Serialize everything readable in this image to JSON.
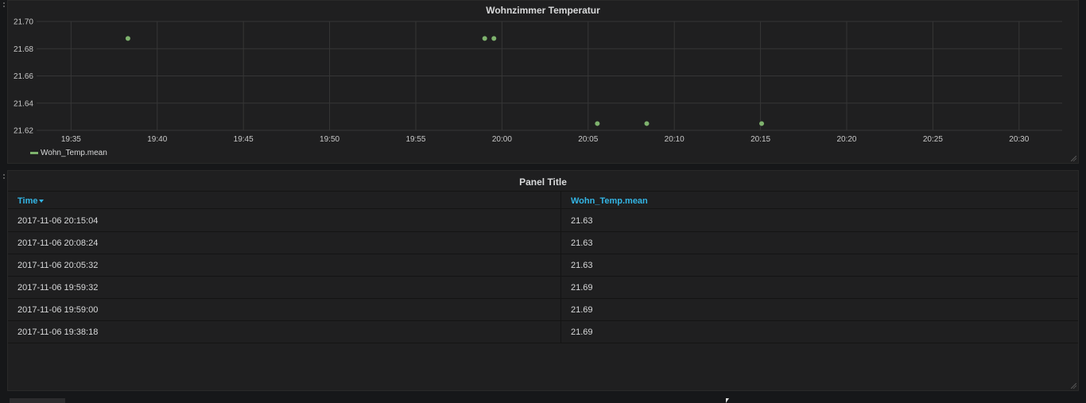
{
  "graph_panel": {
    "title": "Wohnzimmer Temperatur"
  },
  "table_panel": {
    "title": "Panel Title",
    "columns": [
      "Time",
      "Wohn_Temp.mean"
    ],
    "rows": [
      [
        "2017-11-06 20:15:04",
        "21.63"
      ],
      [
        "2017-11-06 20:08:24",
        "21.63"
      ],
      [
        "2017-11-06 20:05:32",
        "21.63"
      ],
      [
        "2017-11-06 19:59:32",
        "21.69"
      ],
      [
        "2017-11-06 19:59:00",
        "21.69"
      ],
      [
        "2017-11-06 19:38:18",
        "21.69"
      ]
    ]
  },
  "colors": {
    "series": "#7eb26d",
    "header_link": "#33b5e5",
    "panel_bg": "#1f1f20",
    "page_bg": "#161719"
  },
  "chart_data": {
    "type": "scatter",
    "title": "Wohnzimmer Temperatur",
    "xlabel": "",
    "ylabel": "",
    "x_ticks": [
      "19:35",
      "19:40",
      "19:45",
      "19:50",
      "19:55",
      "20:00",
      "20:05",
      "20:10",
      "20:15",
      "20:20",
      "20:25",
      "20:30"
    ],
    "y_ticks": [
      "21.62",
      "21.64",
      "21.66",
      "21.68",
      "21.70"
    ],
    "ylim": [
      21.62,
      21.7
    ],
    "xlim": [
      "19:33:00",
      "20:32:30"
    ],
    "grid": true,
    "legend": "bottom-left",
    "series": [
      {
        "name": "Wohn_Temp.mean",
        "color": "#7eb26d",
        "points": [
          {
            "x": "19:38:18",
            "y": 21.6875
          },
          {
            "x": "19:59:00",
            "y": 21.6875
          },
          {
            "x": "19:59:32",
            "y": 21.6875
          },
          {
            "x": "20:05:32",
            "y": 21.625
          },
          {
            "x": "20:08:24",
            "y": 21.625
          },
          {
            "x": "20:15:04",
            "y": 21.625
          }
        ]
      }
    ]
  }
}
